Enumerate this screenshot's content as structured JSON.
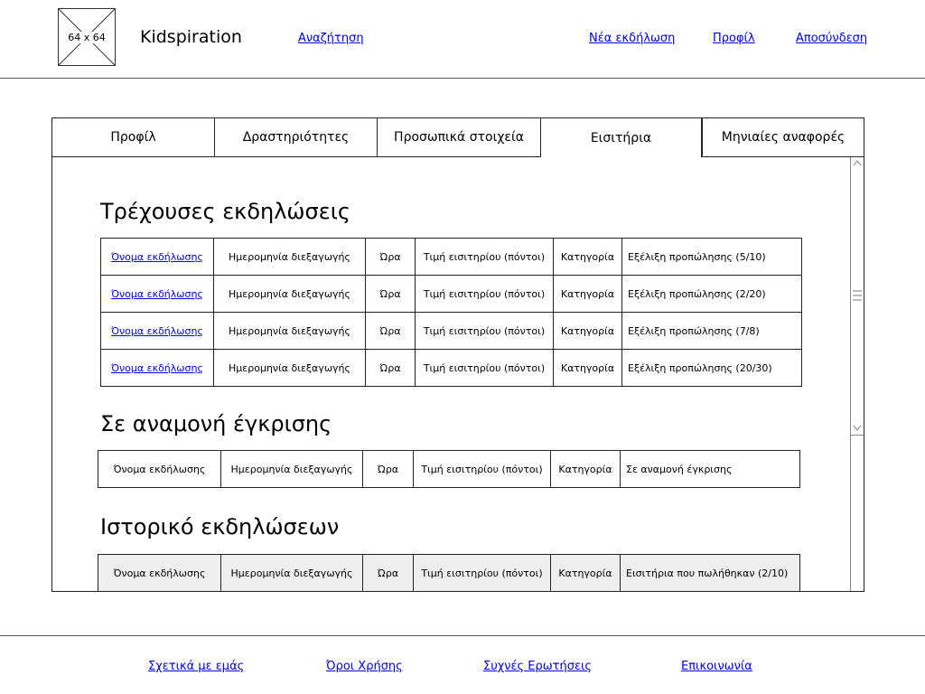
{
  "header": {
    "logo_label": "64 x 64",
    "brand": "Kidspiration",
    "search_link": "Αναζήτηση",
    "new_event_link": "Νέα εκδήλωση",
    "profile_link": "Προφίλ",
    "logout_link": "Αποσύνδεση"
  },
  "tabs": [
    {
      "label": "Προφίλ"
    },
    {
      "label": "Δραστηριότητες"
    },
    {
      "label": "Προσωπικά στοιχεία"
    },
    {
      "label": "Εισιτήρια",
      "active": true
    },
    {
      "label": "Μηνιαίες αναφορές"
    }
  ],
  "sections": {
    "current": {
      "title": "Τρέχουσες εκδηλώσεις",
      "rows": [
        {
          "name": "Όνομα εκδήλωσης",
          "date": "Ημερομηνία διεξαγωγής",
          "time": "Ώρα",
          "price": "Τιμή εισιτηρίου (πόντοι)",
          "category": "Κατηγορία",
          "status": "Εξέλιξη προπώλησης (5/10)"
        },
        {
          "name": "Όνομα εκδήλωσης",
          "date": "Ημερομηνία διεξαγωγής",
          "time": "Ώρα",
          "price": "Τιμή εισιτηρίου (πόντοι)",
          "category": "Κατηγορία",
          "status": "Εξέλιξη προπώλησης (2/20)"
        },
        {
          "name": "Όνομα εκδήλωσης",
          "date": "Ημερομηνία διεξαγωγής",
          "time": "Ώρα",
          "price": "Τιμή εισιτηρίου (πόντοι)",
          "category": "Κατηγορία",
          "status": "Εξέλιξη προπώλησης (7/8)"
        },
        {
          "name": "Όνομα εκδήλωσης",
          "date": "Ημερομηνία διεξαγωγής",
          "time": "Ώρα",
          "price": "Τιμή εισιτηρίου (πόντοι)",
          "category": "Κατηγορία",
          "status": "Εξέλιξη προπώλησης (20/30)"
        }
      ]
    },
    "pending": {
      "title": "Σε αναμονή έγκρισης",
      "rows": [
        {
          "name": "Όνομα εκδήλωσης",
          "date": "Ημερομηνία διεξαγωγής",
          "time": "Ώρα",
          "price": "Τιμή εισιτηρίου (πόντοι)",
          "category": "Κατηγορία",
          "status": "Σε αναμονή έγκρισης"
        }
      ]
    },
    "history": {
      "title": "Ιστορικό εκδηλώσεων",
      "rows": [
        {
          "name": "Όνομα εκδήλωσης",
          "date": "Ημερομηνία διεξαγωγής",
          "time": "Ώρα",
          "price": "Τιμή εισιτηρίου (πόντοι)",
          "category": "Κατηγορία",
          "status": "Εισιτήρια που πωλήθηκαν (2/10)"
        }
      ]
    }
  },
  "footer": {
    "about": "Σχετικά με εμάς",
    "terms": "Όροι Χρήσης",
    "faq": "Συχνές Ερωτήσεις",
    "contact": "Επικοινωνία"
  }
}
